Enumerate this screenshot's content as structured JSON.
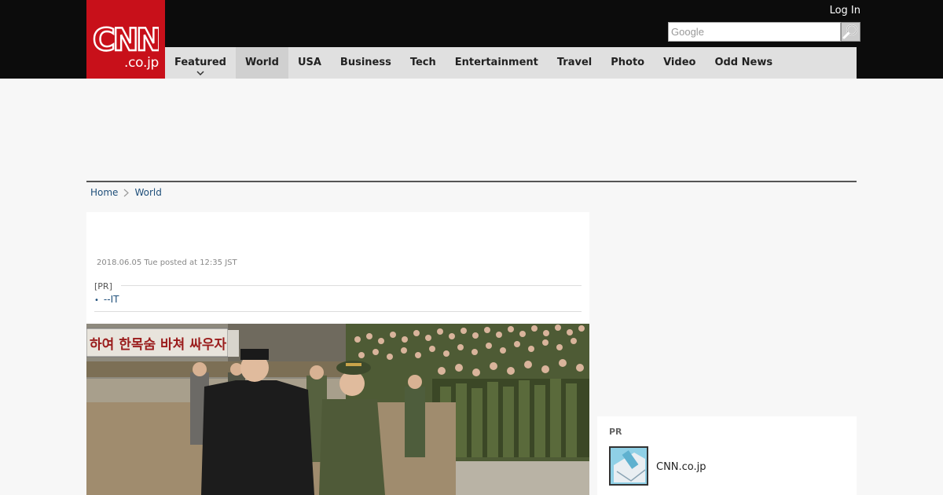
{
  "brand": {
    "logo_text": "CNN",
    "logo_sub": ".co.jp",
    "color": "#c8101a"
  },
  "header": {
    "login_label": "Log In",
    "search_placeholder": "Google",
    "search_icon": "magnifier-icon"
  },
  "nav": {
    "items": [
      {
        "label": "Featured"
      },
      {
        "label": "World"
      },
      {
        "label": "USA"
      },
      {
        "label": "Business"
      },
      {
        "label": "Tech"
      },
      {
        "label": "Entertainment"
      },
      {
        "label": "Travel"
      },
      {
        "label": "Photo"
      },
      {
        "label": "Video"
      },
      {
        "label": "Odd News"
      }
    ],
    "active": "World"
  },
  "breadcrumb": {
    "home": "Home",
    "separator_icon": "chevron-right-icon",
    "current": "World"
  },
  "article": {
    "date": "2018.06.05 Tue posted at 12:35 JST",
    "pr_label": "[PR]",
    "pr_link": "--IT",
    "photo_banner_text": "하여 한목숨 바쳐 싸우자!"
  },
  "sidebar": {
    "pr_title": "PR",
    "item_name": "CNN.co.jp"
  }
}
